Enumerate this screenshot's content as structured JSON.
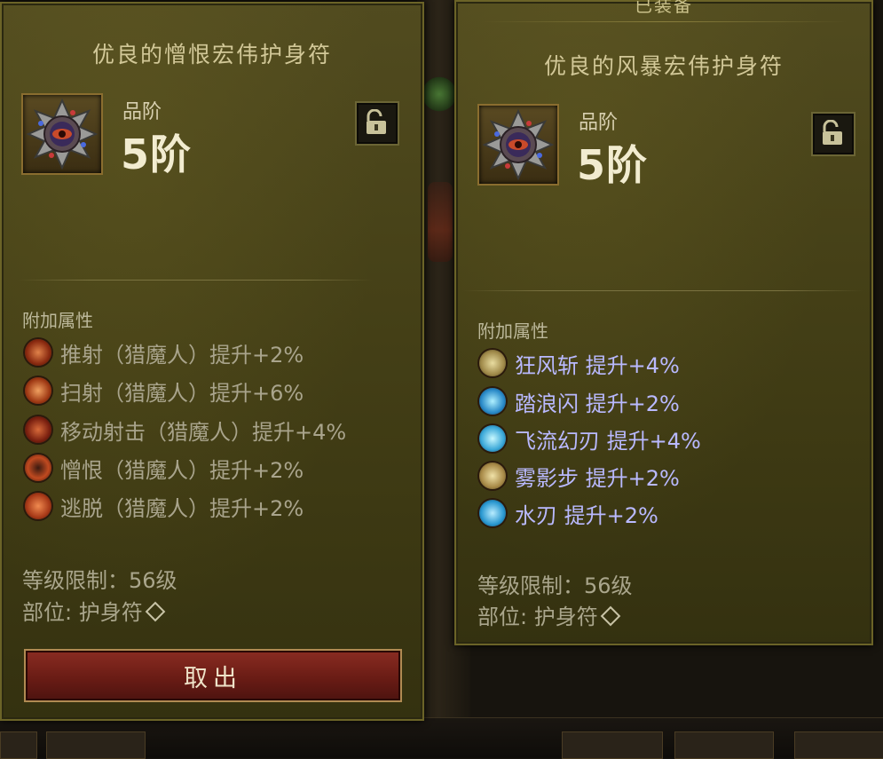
{
  "left_item": {
    "name": "优良的憎恨宏伟护身符",
    "tier_label": "品阶",
    "tier_value": "5阶",
    "attributes_title": "附加属性",
    "attributes": [
      {
        "text": "推射（猎魔人）提升+2%",
        "icon": "push-shot-skill-icon"
      },
      {
        "text": "扫射（猎魔人）提升+6%",
        "icon": "sweep-shot-skill-icon"
      },
      {
        "text": "移动射击（猎魔人）提升+4%",
        "icon": "moving-shot-skill-icon"
      },
      {
        "text": "憎恨（猎魔人）提升+2%",
        "icon": "hatred-skill-icon"
      },
      {
        "text": "逃脱（猎魔人）提升+2%",
        "icon": "escape-skill-icon"
      }
    ],
    "level_req": "等级限制：56级",
    "slot": "部位: 护身符",
    "action_button": "取出"
  },
  "right_item": {
    "equipped_tag": "已装备",
    "name": "优良的风暴宏伟护身符",
    "tier_label": "品阶",
    "tier_value": "5阶",
    "attributes_title": "附加属性",
    "attributes": [
      {
        "text": "狂风斩  提升+4%",
        "icon": "gale-slash-skill-icon"
      },
      {
        "text": "踏浪闪  提升+2%",
        "icon": "wave-dash-skill-icon"
      },
      {
        "text": "飞流幻刃  提升+4%",
        "icon": "flying-blade-skill-icon"
      },
      {
        "text": "雾影步  提升+2%",
        "icon": "mist-step-skill-icon"
      },
      {
        "text": "水刃  提升+2%",
        "icon": "water-blade-skill-icon"
      }
    ],
    "level_req": "等级限制：56级",
    "slot": "部位: 护身符"
  },
  "colors": {
    "panel_bg": "#474218",
    "attr_grey": "#a9a48c",
    "attr_blue": "#b9b9ff",
    "button_red": "#6a1c15"
  }
}
